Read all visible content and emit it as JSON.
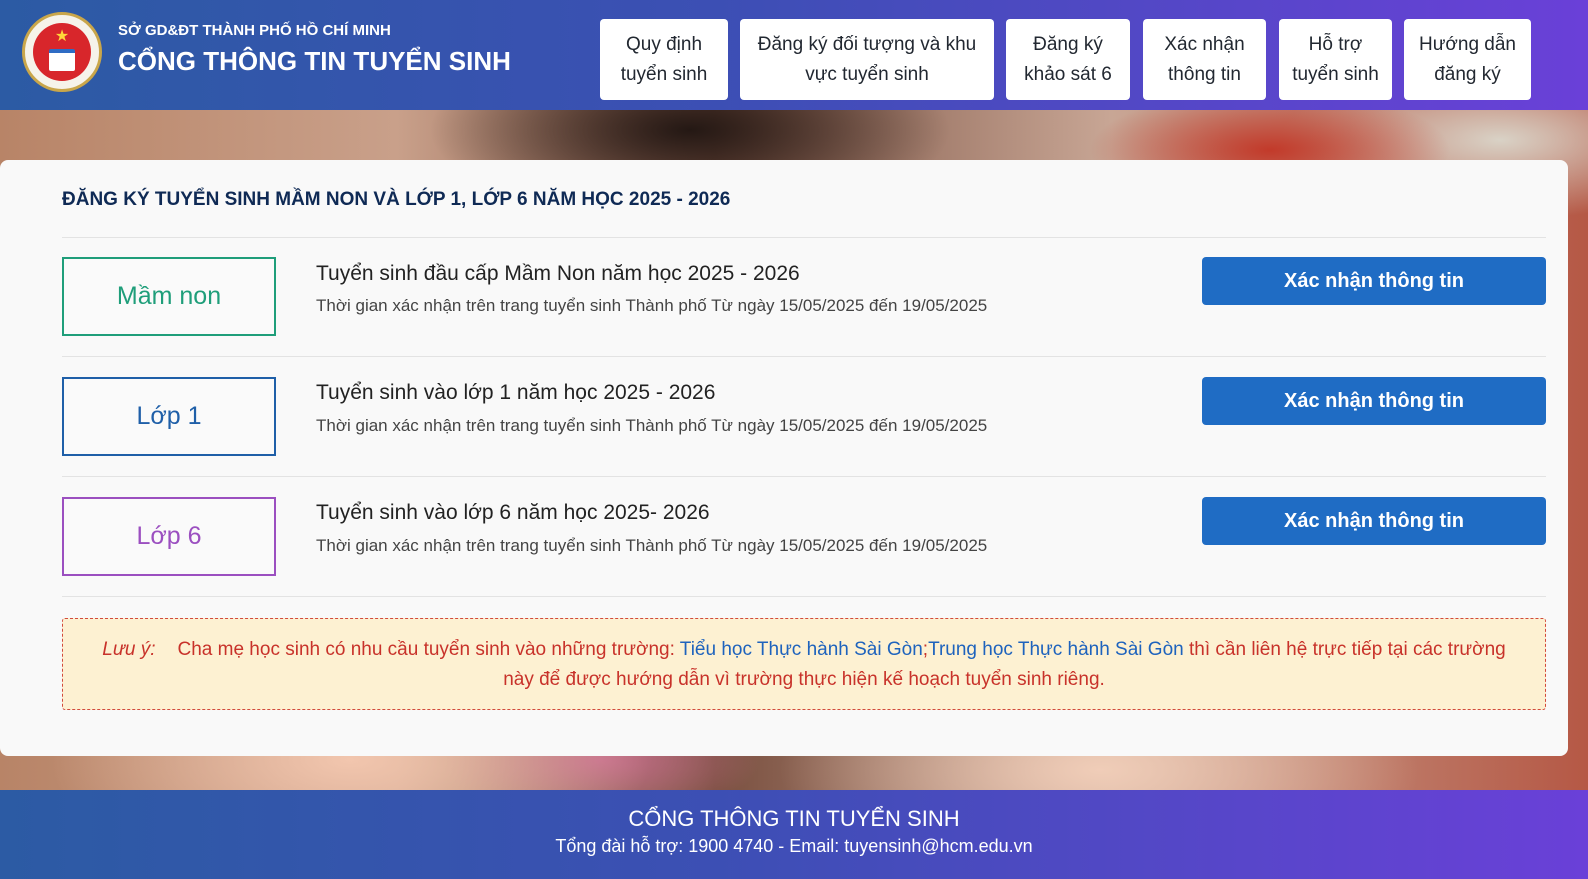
{
  "header": {
    "org_name": "SỞ GD&ĐT THÀNH PHỐ HỒ CHÍ MINH",
    "portal_title": "CỔNG THÔNG TIN TUYỂN SINH",
    "nav": [
      {
        "line1": "Quy định",
        "line2": "tuyển sinh"
      },
      {
        "line1": "Đăng ký đối tượng và khu",
        "line2": "vực tuyển sinh"
      },
      {
        "line1": "Đăng ký",
        "line2": "khảo sát 6"
      },
      {
        "line1": "Xác nhận",
        "line2": "thông tin"
      },
      {
        "line1": "Hỗ trợ",
        "line2": "tuyển sinh"
      },
      {
        "line1": "Hướng dẫn",
        "line2": "đăng ký"
      }
    ]
  },
  "main": {
    "section_title": "ĐĂNG KÝ TUYỂN SINH MẦM NON VÀ LỚP 1, LỚP 6 NĂM HỌC 2025 - 2026",
    "rows": [
      {
        "level": "Mầm non",
        "level_color": "#1f9e7a",
        "title": "Tuyển sinh đầu cấp Mầm Non năm học 2025 - 2026",
        "subtitle": "Thời gian xác nhận trên trang tuyển sinh Thành phố Từ ngày 15/05/2025 đến 19/05/2025",
        "button": "Xác nhận thông tin"
      },
      {
        "level": "Lớp 1",
        "level_color": "#1f5fa8",
        "title": "Tuyển sinh vào lớp 1 năm học 2025 - 2026",
        "subtitle": "Thời gian xác nhận trên trang tuyển sinh Thành phố Từ ngày 15/05/2025 đến 19/05/2025",
        "button": "Xác nhận thông tin"
      },
      {
        "level": "Lớp 6",
        "level_color": "#9b4fc0",
        "title": "Tuyển sinh vào lớp 6 năm học 2025- 2026",
        "subtitle": "Thời gian xác nhận trên trang tuyển sinh Thành phố Từ ngày 15/05/2025 đến 19/05/2025",
        "button": "Xác nhận thông tin"
      }
    ],
    "note": {
      "label": "Lưu ý:",
      "text_before": "Cha mẹ học sinh có nhu cầu tuyển sinh vào những trường: ",
      "link1": "Tiểu học Thực hành Sài Gòn",
      "separator": ";",
      "link2": "Trung học Thực hành Sài Gòn",
      "text_after": " thì cần liên hệ trực tiếp tại các trường này để được hướng dẫn vì trường thực hiện kế hoạch tuyển sinh riêng."
    }
  },
  "footer": {
    "title": "CỔNG THÔNG TIN TUYỂN SINH",
    "contact": "Tổng đài hỗ trợ: 1900 4740 - Email: tuyensinh@hcm.edu.vn"
  }
}
